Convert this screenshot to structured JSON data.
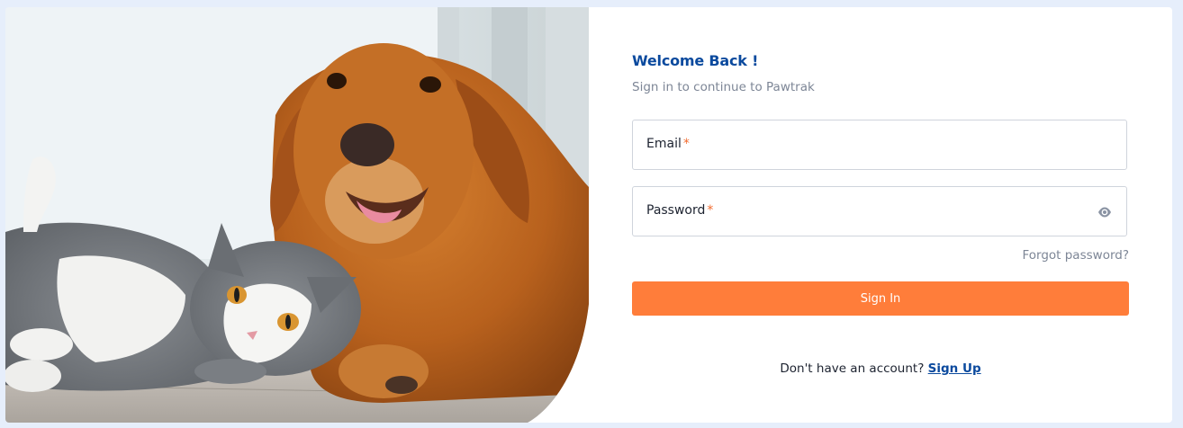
{
  "header": {
    "title": "Welcome Back !",
    "subtitle": "Sign in to continue to Pawtrak"
  },
  "fields": {
    "email": {
      "label": "Email",
      "required_mark": "*",
      "value": ""
    },
    "password": {
      "label": "Password",
      "required_mark": "*",
      "value": "",
      "toggle_icon": "eye-icon"
    }
  },
  "links": {
    "forgot_password": "Forgot password?",
    "no_account_text": "Don't have an account?",
    "sign_up": "Sign Up"
  },
  "buttons": {
    "sign_in": "Sign In"
  },
  "colors": {
    "brand": "#0b4a9e",
    "accent": "#ff7d3a",
    "required": "#f26b2f",
    "muted": "#7d8696",
    "page_background": "#e6eefb"
  },
  "hero_image": {
    "subject": "golden retriever and grey-white cat lying together"
  }
}
